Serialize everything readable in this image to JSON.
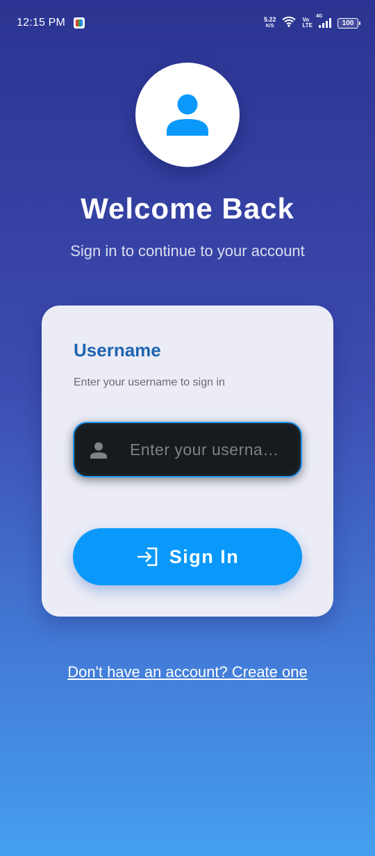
{
  "status_bar": {
    "time": "12:15 PM",
    "net_speed_value": "5.22",
    "net_speed_unit": "K/S",
    "volte_top": "Vo",
    "volte_bottom": "LTE",
    "network_type": "4G",
    "battery": "100",
    "icons": [
      "app-notification-icon",
      "wifi-icon",
      "signal-icon",
      "battery-icon"
    ]
  },
  "header": {
    "avatar_icon": "user-icon",
    "title": "Welcome Back",
    "subtitle": "Sign in to continue to your account"
  },
  "form": {
    "title": "Username",
    "description": "Enter your username to sign in",
    "username_placeholder": "Enter your userna…",
    "username_value": "",
    "input_icon": "person-icon",
    "signin_label": "Sign In",
    "signin_icon": "login-icon"
  },
  "footer": {
    "create_account_link": "Don't have an account? Create one"
  },
  "colors": {
    "gradient_top": "#2b3491",
    "gradient_bottom": "#459ff0",
    "accent": "#0a99fb",
    "title_blue": "#1f64b0",
    "card_bg": "#ebecf6",
    "input_bg": "#161b20"
  }
}
